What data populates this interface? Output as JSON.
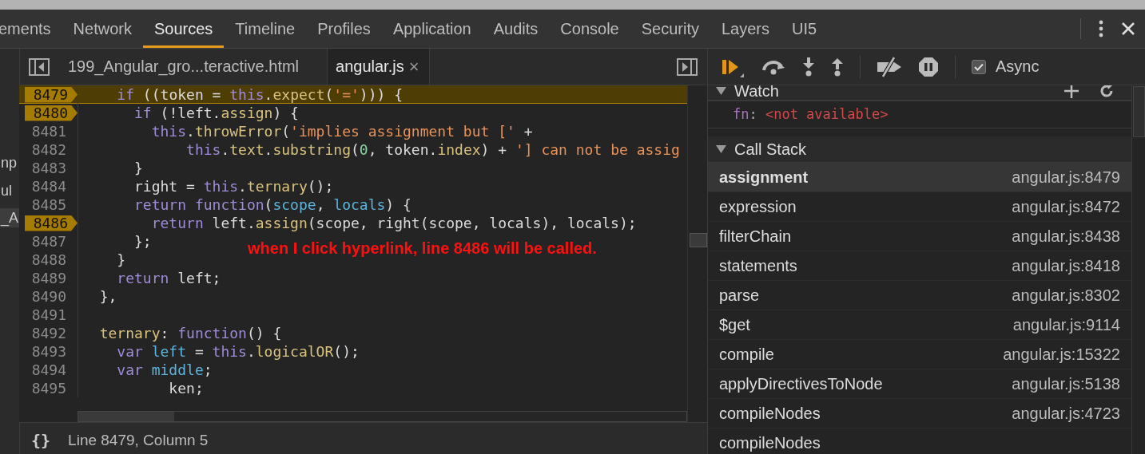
{
  "main_tabs": [
    {
      "label": "ements",
      "selected": false
    },
    {
      "label": "Network",
      "selected": false
    },
    {
      "label": "Sources",
      "selected": true
    },
    {
      "label": "Timeline",
      "selected": false
    },
    {
      "label": "Profiles",
      "selected": false
    },
    {
      "label": "Application",
      "selected": false
    },
    {
      "label": "Audits",
      "selected": false
    },
    {
      "label": "Console",
      "selected": false
    },
    {
      "label": "Security",
      "selected": false
    },
    {
      "label": "Layers",
      "selected": false
    },
    {
      "label": "UI5",
      "selected": false
    }
  ],
  "navigator_fragments": [
    {
      "text": "np",
      "selected": false
    },
    {
      "text": "ul",
      "selected": false
    },
    {
      "text": "_A",
      "selected": true
    }
  ],
  "editor_tabs": [
    {
      "label": "199_Angular_gro...teractive.html",
      "selected": false,
      "closable": false
    },
    {
      "label": "angular.js",
      "selected": true,
      "closable": true
    }
  ],
  "close_glyph": "×",
  "code": {
    "lines": [
      {
        "number": "8479",
        "breakpoint": true,
        "current": true,
        "tokens": [
          {
            "kind": "kw",
            "text": "    if"
          },
          {
            "kind": "plain",
            "text": " ((token = "
          },
          {
            "kind": "kw",
            "text": "this"
          },
          {
            "kind": "plain",
            "text": "."
          },
          {
            "kind": "fn",
            "text": "expect"
          },
          {
            "kind": "plain",
            "text": "("
          },
          {
            "kind": "str",
            "text": "'='"
          },
          {
            "kind": "plain",
            "text": "))) {"
          }
        ]
      },
      {
        "number": "8480",
        "breakpoint": true,
        "current": false,
        "tokens": [
          {
            "kind": "kw",
            "text": "      if"
          },
          {
            "kind": "plain",
            "text": " (!left."
          },
          {
            "kind": "fn",
            "text": "assign"
          },
          {
            "kind": "plain",
            "text": ") {"
          }
        ]
      },
      {
        "number": "8481",
        "breakpoint": false,
        "current": false,
        "tokens": [
          {
            "kind": "kw",
            "text": "        this"
          },
          {
            "kind": "plain",
            "text": "."
          },
          {
            "kind": "fn",
            "text": "throwError"
          },
          {
            "kind": "plain",
            "text": "("
          },
          {
            "kind": "str",
            "text": "'implies assignment but ['"
          },
          {
            "kind": "plain",
            "text": " +"
          }
        ]
      },
      {
        "number": "8482",
        "breakpoint": false,
        "current": false,
        "tokens": [
          {
            "kind": "kw",
            "text": "            this"
          },
          {
            "kind": "plain",
            "text": "."
          },
          {
            "kind": "fn",
            "text": "text"
          },
          {
            "kind": "plain",
            "text": "."
          },
          {
            "kind": "fn",
            "text": "substring"
          },
          {
            "kind": "plain",
            "text": "("
          },
          {
            "kind": "num",
            "text": "0"
          },
          {
            "kind": "plain",
            "text": ", token."
          },
          {
            "kind": "fn",
            "text": "index"
          },
          {
            "kind": "plain",
            "text": ") + "
          },
          {
            "kind": "str",
            "text": "'] can not be assig"
          }
        ]
      },
      {
        "number": "8483",
        "breakpoint": false,
        "current": false,
        "tokens": [
          {
            "kind": "plain",
            "text": "      }"
          }
        ]
      },
      {
        "number": "8484",
        "breakpoint": false,
        "current": false,
        "tokens": [
          {
            "kind": "plain",
            "text": "      right = "
          },
          {
            "kind": "kw",
            "text": "this"
          },
          {
            "kind": "plain",
            "text": "."
          },
          {
            "kind": "fn",
            "text": "ternary"
          },
          {
            "kind": "plain",
            "text": "();"
          }
        ]
      },
      {
        "number": "8485",
        "breakpoint": false,
        "current": false,
        "tokens": [
          {
            "kind": "kw",
            "text": "      return"
          },
          {
            "kind": "kw",
            "text": " function"
          },
          {
            "kind": "plain",
            "text": "("
          },
          {
            "kind": "var",
            "text": "scope"
          },
          {
            "kind": "plain",
            "text": ", "
          },
          {
            "kind": "var",
            "text": "locals"
          },
          {
            "kind": "plain",
            "text": ") {"
          }
        ]
      },
      {
        "number": "8486",
        "breakpoint": true,
        "current": false,
        "tokens": [
          {
            "kind": "kw",
            "text": "        return"
          },
          {
            "kind": "plain",
            "text": " left."
          },
          {
            "kind": "fn",
            "text": "assign"
          },
          {
            "kind": "plain",
            "text": "(scope, right(scope, locals), locals);"
          }
        ]
      },
      {
        "number": "8487",
        "breakpoint": false,
        "current": false,
        "tokens": [
          {
            "kind": "plain",
            "text": "      };"
          }
        ]
      },
      {
        "number": "8488",
        "breakpoint": false,
        "current": false,
        "tokens": [
          {
            "kind": "plain",
            "text": "    }"
          }
        ]
      },
      {
        "number": "8489",
        "breakpoint": false,
        "current": false,
        "tokens": [
          {
            "kind": "kw",
            "text": "    return"
          },
          {
            "kind": "plain",
            "text": " left;"
          }
        ]
      },
      {
        "number": "8490",
        "breakpoint": false,
        "current": false,
        "tokens": [
          {
            "kind": "plain",
            "text": "  },"
          }
        ]
      },
      {
        "number": "8491",
        "breakpoint": false,
        "current": false
      },
      {
        "number": "8492",
        "breakpoint": false,
        "current": false,
        "tokens": [
          {
            "kind": "fn",
            "text": "  ternary"
          },
          {
            "kind": "plain",
            "text": ": "
          },
          {
            "kind": "kw",
            "text": "function"
          },
          {
            "kind": "plain",
            "text": "() {"
          }
        ]
      },
      {
        "number": "8493",
        "breakpoint": false,
        "current": false,
        "tokens": [
          {
            "kind": "kw",
            "text": "    var"
          },
          {
            "kind": "var",
            "text": " left"
          },
          {
            "kind": "plain",
            "text": " = "
          },
          {
            "kind": "kw",
            "text": "this"
          },
          {
            "kind": "plain",
            "text": "."
          },
          {
            "kind": "fn",
            "text": "logicalOR"
          },
          {
            "kind": "plain",
            "text": "();"
          }
        ]
      },
      {
        "number": "8494",
        "breakpoint": false,
        "current": false,
        "tokens": [
          {
            "kind": "kw",
            "text": "    var"
          },
          {
            "kind": "var",
            "text": " middle"
          },
          {
            "kind": "plain",
            "text": ";"
          }
        ]
      },
      {
        "number": "8495",
        "breakpoint": false,
        "current": false,
        "tokens": [
          {
            "kind": "plain",
            "text": "          ken;"
          }
        ]
      }
    ],
    "annotation": "when I click hyperlink, line 8486 will be called."
  },
  "status_bar": {
    "format_glyph": "{}",
    "position": "Line 8479, Column 5"
  },
  "debugger": {
    "async": {
      "label": "Async",
      "checked": true
    },
    "watch": {
      "title": "Watch",
      "expanded": true,
      "items": [
        {
          "name": "fn",
          "separator": ":",
          "value": "<not available>"
        }
      ]
    },
    "call_stack": {
      "title": "Call Stack",
      "expanded": true,
      "frames": [
        {
          "function": "assignment",
          "location": "angular.js:8479",
          "selected": true
        },
        {
          "function": "expression",
          "location": "angular.js:8472",
          "selected": false
        },
        {
          "function": "filterChain",
          "location": "angular.js:8438",
          "selected": false
        },
        {
          "function": "statements",
          "location": "angular.js:8418",
          "selected": false
        },
        {
          "function": "parse",
          "location": "angular.js:8302",
          "selected": false
        },
        {
          "function": "$get",
          "location": "angular.js:9114",
          "selected": false
        },
        {
          "function": "compile",
          "location": "angular.js:15322",
          "selected": false
        },
        {
          "function": "applyDirectivesToNode",
          "location": "angular.js:5138",
          "selected": false
        },
        {
          "function": "compileNodes",
          "location": "angular.js:4723",
          "selected": false
        },
        {
          "function": "compileNodes",
          "selected": false
        }
      ]
    }
  }
}
